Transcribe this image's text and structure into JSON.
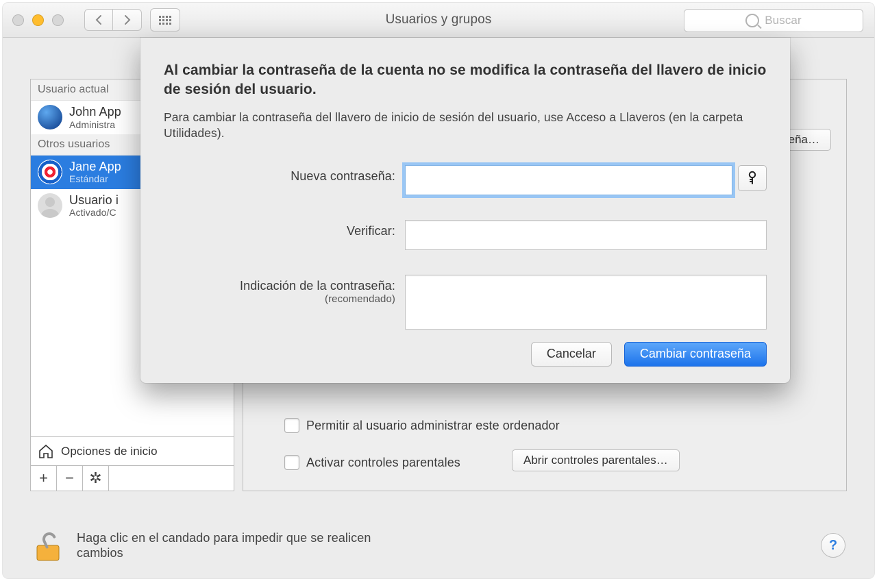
{
  "window": {
    "title": "Usuarios y grupos"
  },
  "search": {
    "placeholder": "Buscar"
  },
  "sidebar": {
    "current_header": "Usuario actual",
    "other_header": "Otros usuarios",
    "users": [
      {
        "name": "John App",
        "role": "Administra"
      },
      {
        "name": "Jane App",
        "role": "Estándar"
      },
      {
        "name": "Usuario i",
        "role": "Activado/C"
      }
    ],
    "login_options": "Opciones de inicio"
  },
  "panel": {
    "change_password_button": "traseña…",
    "allow_admin": "Permitir al usuario administrar este ordenador",
    "parental_enable": "Activar controles parentales",
    "parental_open": "Abrir controles parentales…"
  },
  "footer": {
    "text": "Haga clic en el candado para impedir que se realicen cambios"
  },
  "sheet": {
    "heading": "Al cambiar la contraseña de la cuenta no se modifica la contraseña del llavero de inicio de sesión del usuario.",
    "description": "Para cambiar la contraseña del llavero de inicio de sesión del usuario, use Acceso a Llaveros (en la carpeta Utilidades).",
    "new_password_label": "Nueva contraseña:",
    "verify_label": "Verificar:",
    "hint_label": "Indicación de la contraseña:",
    "hint_sublabel": "(recomendado)",
    "cancel": "Cancelar",
    "confirm": "Cambiar contraseña"
  }
}
